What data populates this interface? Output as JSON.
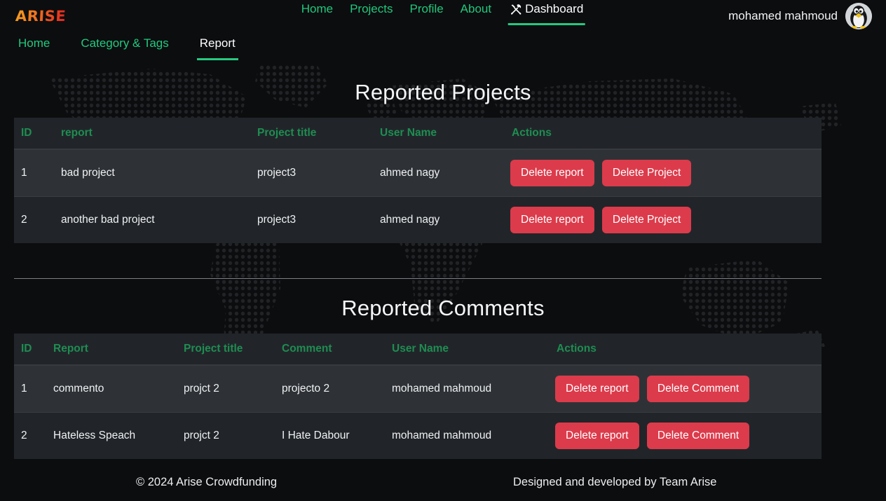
{
  "header": {
    "brand": "ARISE",
    "nav": [
      {
        "label": "Home",
        "active": false,
        "icon": null
      },
      {
        "label": "Projects",
        "active": false,
        "icon": null
      },
      {
        "label": "Profile",
        "active": false,
        "icon": null
      },
      {
        "label": "About",
        "active": false,
        "icon": null
      },
      {
        "label": "Dashboard",
        "active": true,
        "icon": "hammer-and-wrench-icon"
      }
    ],
    "user_name": "mohamed mahmoud",
    "avatar_icon": "penguin-avatar-icon"
  },
  "subnav": [
    {
      "label": "Home",
      "active": false
    },
    {
      "label": "Category & Tags",
      "active": false
    },
    {
      "label": "Report",
      "active": true
    }
  ],
  "projects_section": {
    "title": "Reported Projects",
    "columns": [
      "ID",
      "report",
      "Project title",
      "User Name",
      "Actions"
    ],
    "rows": [
      {
        "id": "1",
        "report": "bad project",
        "project_title": "project3",
        "user_name": "ahmed nagy",
        "actions": [
          "Delete report",
          "Delete Project"
        ]
      },
      {
        "id": "2",
        "report": "another bad project",
        "project_title": "project3",
        "user_name": "ahmed nagy",
        "actions": [
          "Delete report",
          "Delete Project"
        ]
      }
    ]
  },
  "comments_section": {
    "title": "Reported Comments",
    "columns": [
      "ID",
      "Report",
      "Project title",
      "Comment",
      "User Name",
      "Actions"
    ],
    "rows": [
      {
        "id": "1",
        "report": "commento",
        "project_title": "projct 2",
        "comment": "projecto 2",
        "user_name": "mohamed mahmoud",
        "actions": [
          "Delete report",
          "Delete Comment"
        ]
      },
      {
        "id": "2",
        "report": "Hateless Speach",
        "project_title": "projct 2",
        "comment": "I Hate Dabour",
        "user_name": "mohamed mahmoud",
        "actions": [
          "Delete report",
          "Delete Comment"
        ]
      }
    ]
  },
  "footer": {
    "copyright": "© 2024 Arise Crowdfunding",
    "credit": "Designed and developed by Team Arise"
  },
  "colors": {
    "page_background": "#0c0d0f",
    "accent_green": "#22c97e",
    "header_green": "#1f8d52",
    "danger_red": "#dc3b4b",
    "row_light": "#2e3236",
    "row_dark": "#212529",
    "brand_gradient_from": "#f4a020",
    "brand_gradient_to": "#e2221f"
  }
}
